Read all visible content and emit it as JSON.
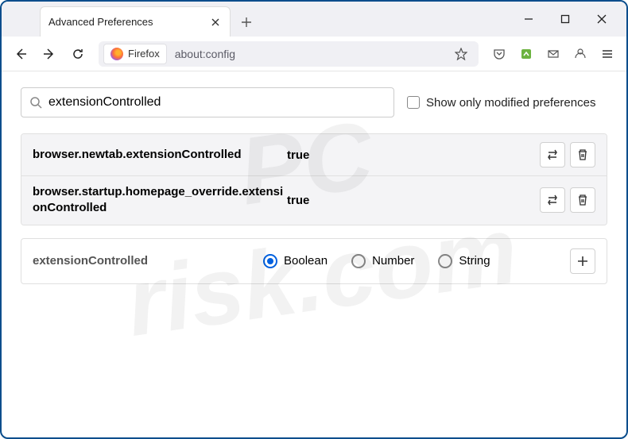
{
  "window": {
    "tab_title": "Advanced Preferences"
  },
  "urlbar": {
    "identity_label": "Firefox",
    "url": "about:config"
  },
  "search": {
    "value": "extensionControlled",
    "checkbox_label": "Show only modified preferences"
  },
  "prefs": [
    {
      "name": "browser.newtab.extensionControlled",
      "value": "true"
    },
    {
      "name": "browser.startup.homepage_override.extensionControlled",
      "value": "true"
    }
  ],
  "new_pref": {
    "name": "extensionControlled",
    "types": [
      "Boolean",
      "Number",
      "String"
    ],
    "selected": 0
  }
}
